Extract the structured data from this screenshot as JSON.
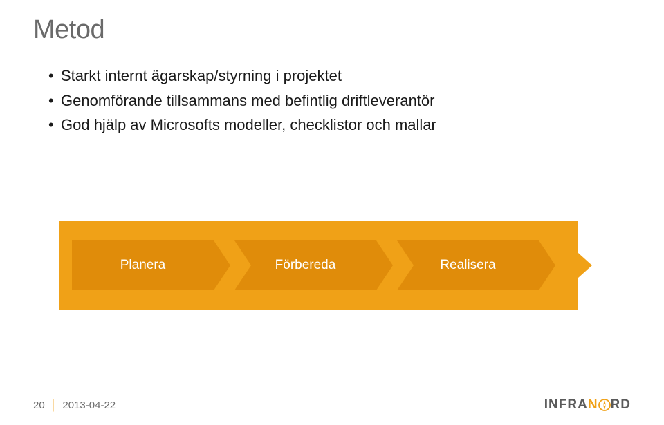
{
  "title": "Metod",
  "bullets": [
    "Starkt internt ägarskap/styrning i projektet",
    "Genomförande tillsammans med befintlig driftleverantör",
    "God hjälp av Microsofts modeller, checklistor och mallar"
  ],
  "steps": [
    "Planera",
    "Förbereda",
    "Realisera"
  ],
  "footer": {
    "page": "20",
    "date": "2013-04-22"
  },
  "logo": {
    "prefix": "INFRA",
    "suffix": "RD",
    "accent": "N",
    "o_replacement": "compass"
  }
}
